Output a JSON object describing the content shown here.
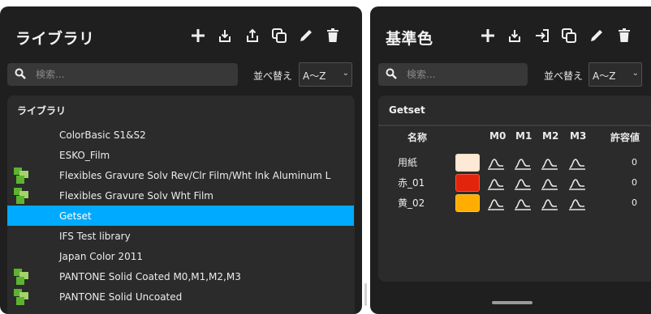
{
  "library_panel": {
    "title": "ライブラリ",
    "search": {
      "placeholder": "検索..."
    },
    "sort": {
      "label": "並べ替え",
      "value": "A〜Z"
    },
    "list": {
      "header": "ライブラリ",
      "items": [
        {
          "label": "ColorBasic S1&S2",
          "icon": "none"
        },
        {
          "label": "ESKO_Film",
          "icon": "none"
        },
        {
          "label": "Flexibles Gravure Solv Rev/Clr Film/Wht Ink Aluminum L",
          "icon": "library-swatches-icon"
        },
        {
          "label": "Flexibles Gravure Solv Wht Film",
          "icon": "library-swatches-icon"
        },
        {
          "label": "Getset",
          "icon": "none"
        },
        {
          "label": "IFS Test library",
          "icon": "none"
        },
        {
          "label": "Japan Color 2011",
          "icon": "none"
        },
        {
          "label": "PANTONE Solid Coated M0,M1,M2,M3",
          "icon": "library-swatches-icon"
        },
        {
          "label": "PANTONE Solid Uncoated",
          "icon": "library-swatches-icon"
        }
      ],
      "selected": "Getset"
    }
  },
  "standard_panel": {
    "title": "基準色",
    "search": {
      "placeholder": "検索..."
    },
    "sort": {
      "label": "並べ替え",
      "value": "A〜Z"
    },
    "table": {
      "title": "Getset",
      "columns": [
        "名称",
        "M0",
        "M1",
        "M2",
        "M3",
        "許容値"
      ],
      "rows": [
        {
          "name": "用紙",
          "color": "#fde9d5",
          "tolerance": "0"
        },
        {
          "name": "赤_01",
          "color": "#e3240d",
          "tolerance": "0"
        },
        {
          "name": "黄_02",
          "color": "#ffad00",
          "tolerance": "0"
        }
      ]
    }
  },
  "colors": {
    "accent": "#00aaff",
    "panel_bg": "#1f1f1f",
    "list_bg": "#2b2b2b",
    "icon_green": "#5db32f",
    "icon_green_light": "#a5d36b"
  }
}
